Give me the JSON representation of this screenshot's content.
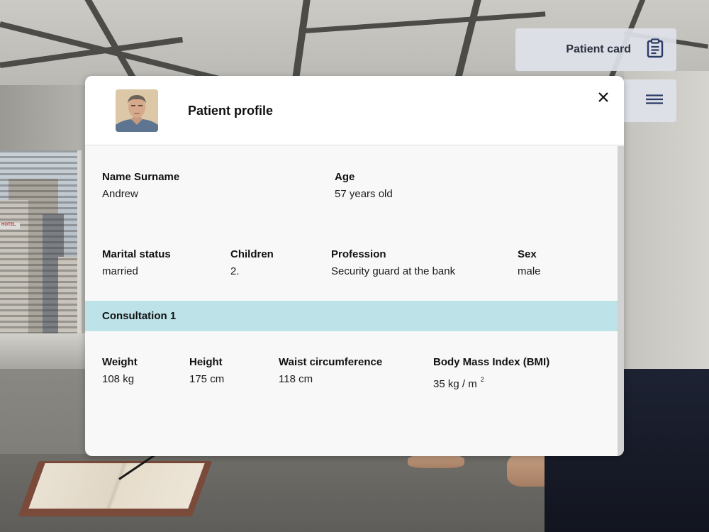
{
  "toolbar": {
    "patient_card_label": "Patient card",
    "patient_card_icon": "clipboard-icon",
    "menu_icon": "hamburger-menu-icon"
  },
  "modal": {
    "title": "Patient profile",
    "close_icon": "close-icon",
    "profile": {
      "name": {
        "label": "Name Surname",
        "value": "Andrew"
      },
      "age": {
        "label": "Age",
        "value": "57 years old"
      },
      "marital_status": {
        "label": "Marital status",
        "value": "married"
      },
      "children": {
        "label": "Children",
        "value": "2."
      },
      "profession": {
        "label": "Profession",
        "value": "Security guard at the bank"
      },
      "sex": {
        "label": "Sex",
        "value": "male"
      }
    },
    "consultation": {
      "title": "Consultation 1",
      "weight": {
        "label": "Weight",
        "value": "108 kg"
      },
      "height": {
        "label": "Height",
        "value": "175 cm"
      },
      "waist": {
        "label": "Waist circumference",
        "value": "118 cm"
      },
      "bmi": {
        "label": "Body Mass Index (BMI)",
        "value": "35 kg / m",
        "unit_exponent": "2"
      }
    }
  },
  "colors": {
    "section_bar": "#bde3e9",
    "button_bg": "#dee2e9",
    "icon": "#2c3a66"
  }
}
